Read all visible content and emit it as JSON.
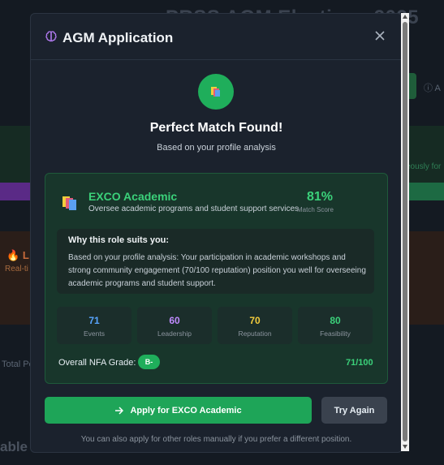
{
  "background": {
    "title": "PRSS AGM Elections 2025",
    "info_label": "A",
    "right_text": "eously for",
    "fire_label": "L",
    "realtime_label": "Real-ti",
    "total_label": "Total Po",
    "able_label": "able"
  },
  "modal": {
    "title": "AGM Application",
    "hero_title": "Perfect Match Found!",
    "hero_subtitle": "Based on your profile analysis",
    "match": {
      "role_title": "EXCO Academic",
      "role_description": "Oversee academic programs and student support services",
      "score": "81%",
      "score_label": "Match Score",
      "why_title": "Why this role suits you:",
      "why_text": "Based on your profile analysis: Your participation in academic workshops and strong community engagement (70/100 reputation) position you well for overseeing academic programs and student support.",
      "stats": [
        {
          "value": "71",
          "label": "Events",
          "color": "#58a6ff"
        },
        {
          "value": "60",
          "label": "Leadership",
          "color": "#c08bff"
        },
        {
          "value": "70",
          "label": "Reputation",
          "color": "#f2cc3c"
        },
        {
          "value": "80",
          "label": "Feasibility",
          "color": "#3bd17a"
        }
      ],
      "grade_label": "Overall NFA Grade:",
      "grade": "B-",
      "grade_score": "71/100"
    },
    "apply_label": "Apply for EXCO Academic",
    "retry_label": "Try Again",
    "footnote": "You can also apply for other roles manually if you prefer a different position."
  },
  "icons": {
    "brain": "brain-icon",
    "close": "close-icon",
    "books": "books-icon",
    "arrow": "arrow-right-icon"
  }
}
